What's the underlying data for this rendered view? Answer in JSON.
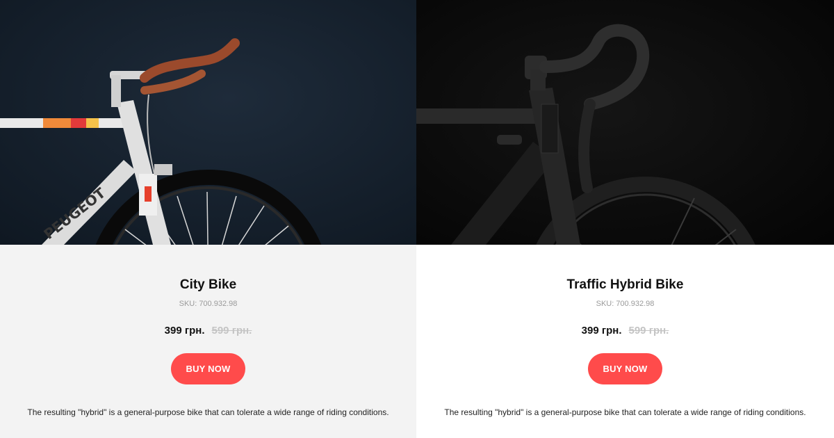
{
  "products": [
    {
      "title": "City Bike",
      "sku_label": "SKU:",
      "sku": "700.932.98",
      "price": "399 грн.",
      "old_price": "599 грн.",
      "button_label": "BUY NOW",
      "description": "The resulting \"hybrid\" is a general-purpose bike that can tolerate a wide range of riding conditions.",
      "frame_text": "PEUGEOT"
    },
    {
      "title": "Traffic Hybrid Bike",
      "sku_label": "SKU:",
      "sku": "700.932.98",
      "price": "399 грн.",
      "old_price": "599 грн.",
      "button_label": "BUY NOW",
      "description": "The resulting \"hybrid\" is a general-purpose bike that can tolerate a wide range of riding conditions."
    }
  ],
  "colors": {
    "accent": "#ff4b4b",
    "left_panel_bg": "#f3f3f3",
    "right_panel_bg": "#ffffff",
    "old_price": "#c4c4c4"
  }
}
